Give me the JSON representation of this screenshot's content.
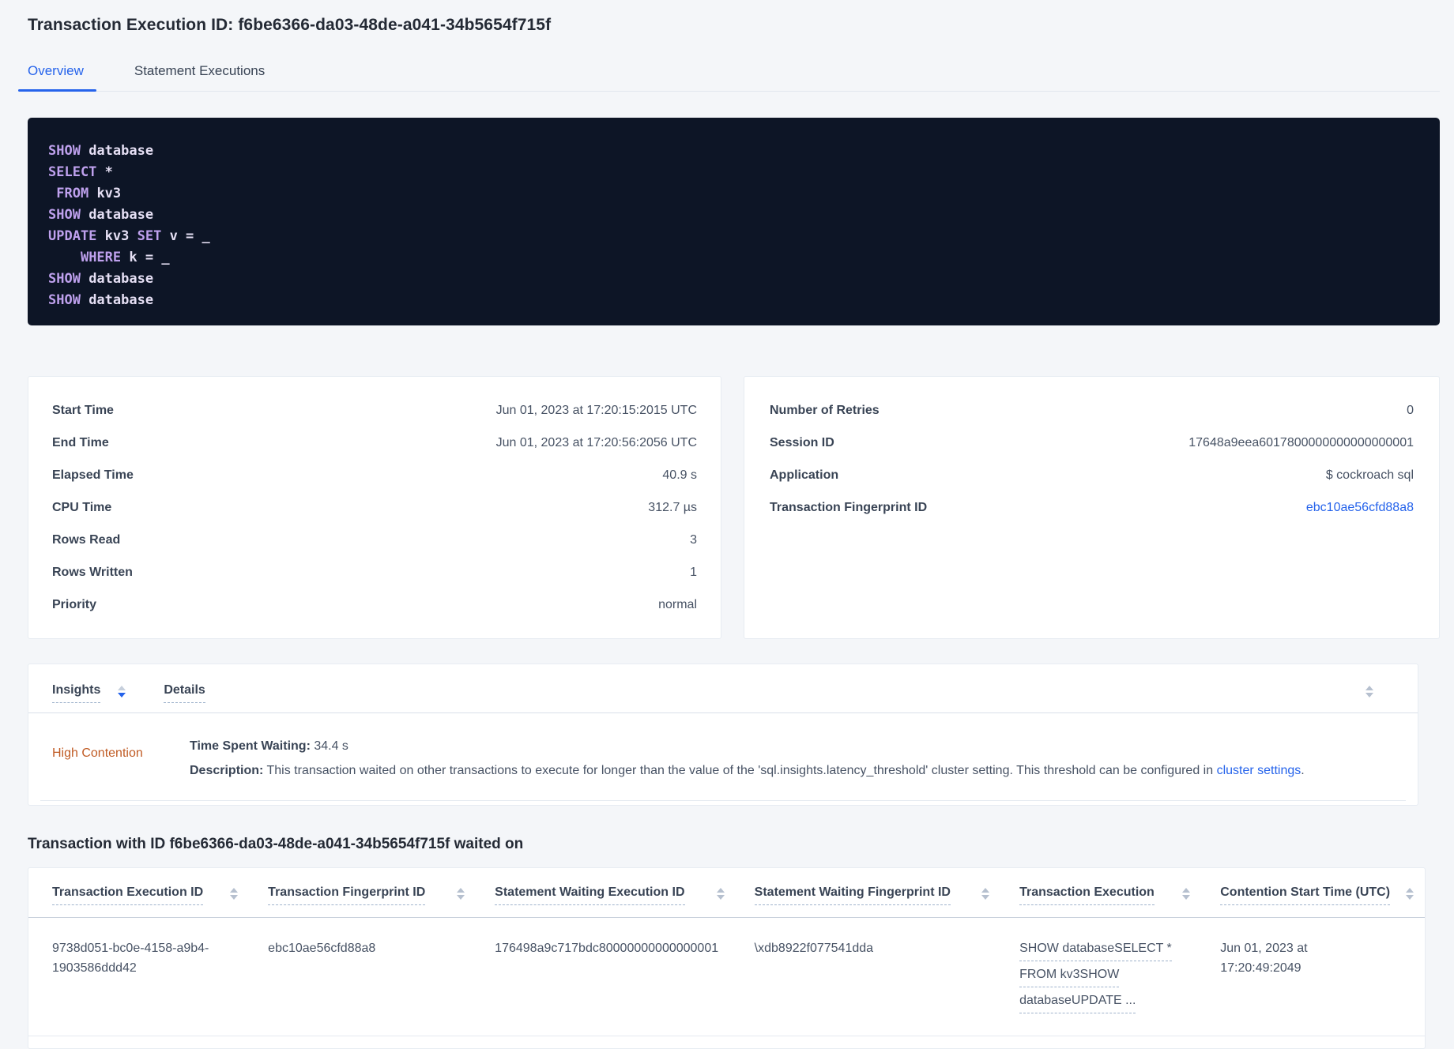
{
  "header": {
    "title": "Transaction Execution ID: f6be6366-da03-48de-a041-34b5654f715f"
  },
  "tabs": {
    "overview": "Overview",
    "statement_executions": "Statement Executions"
  },
  "sql": {
    "lines": [
      [
        "SHOW",
        " database"
      ],
      [
        "SELECT",
        " *"
      ],
      [
        " ",
        "FROM",
        " kv3"
      ],
      [
        "SHOW",
        " database"
      ],
      [
        "UPDATE",
        " kv3 ",
        "SET",
        " v = _"
      ],
      [
        "    ",
        "WHERE",
        " k = _"
      ],
      [
        "SHOW",
        " database"
      ],
      [
        "SHOW",
        " database"
      ]
    ]
  },
  "summary_left": {
    "rows": [
      {
        "label": "Start Time",
        "value": "Jun 01, 2023 at 17:20:15:2015 UTC"
      },
      {
        "label": "End Time",
        "value": "Jun 01, 2023 at 17:20:56:2056 UTC"
      },
      {
        "label": "Elapsed Time",
        "value": "40.9 s"
      },
      {
        "label": "CPU Time",
        "value": "312.7 µs"
      },
      {
        "label": "Rows Read",
        "value": "3"
      },
      {
        "label": "Rows Written",
        "value": "1"
      },
      {
        "label": "Priority",
        "value": "normal"
      }
    ]
  },
  "summary_right": {
    "rows": [
      {
        "label": "Number of Retries",
        "value": "0"
      },
      {
        "label": "Session ID",
        "value": "17648a9eea6017800000000000000001"
      },
      {
        "label": "Application",
        "value": "$ cockroach sql"
      },
      {
        "label": "Transaction Fingerprint ID",
        "value": "ebc10ae56cfd88a8"
      }
    ]
  },
  "insights": {
    "col_insights": "Insights",
    "col_details": "Details",
    "row": {
      "insight": "High Contention",
      "waiting_label": "Time Spent Waiting:",
      "waiting_value": " 34.4 s",
      "description_label": "Description:",
      "description_text": " This transaction waited on other transactions to execute for longer than the value of the 'sql.insights.latency_threshold' cluster setting. This threshold can be configured in ",
      "description_link": "cluster settings",
      "description_suffix": "."
    }
  },
  "waited_on": {
    "heading": "Transaction with ID f6be6366-da03-48de-a041-34b5654f715f waited on",
    "columns": [
      "Transaction Execution ID",
      "Transaction Fingerprint ID",
      "Statement Waiting Execution ID",
      "Statement Waiting Fingerprint ID",
      "Transaction Execution",
      "Contention Start Time (UTC)"
    ],
    "row": {
      "transaction_execution_id": "9738d051-bc0e-4158-a9b4-1903586ddd42",
      "transaction_fingerprint_id": "ebc10ae56cfd88a8",
      "statement_waiting_execution_id": "176498a9c717bdc80000000000000001",
      "statement_waiting_fingerprint_id": "\\xdb8922f077541dda",
      "transaction_execution_lines": [
        "SHOW databaseSELECT *",
        "FROM kv3SHOW",
        "databaseUPDATE ..."
      ],
      "contention_start_time": "Jun 01, 2023 at 17:20:49:2049"
    }
  },
  "colors": {
    "accent_blue": "#2563eb",
    "insight_orange": "#c05b24",
    "sql_keyword_purple": "#bfa1ee",
    "sql_identifier": "#e5dff4",
    "sql_background": "#0d1526",
    "page_background": "#f4f6f9"
  }
}
